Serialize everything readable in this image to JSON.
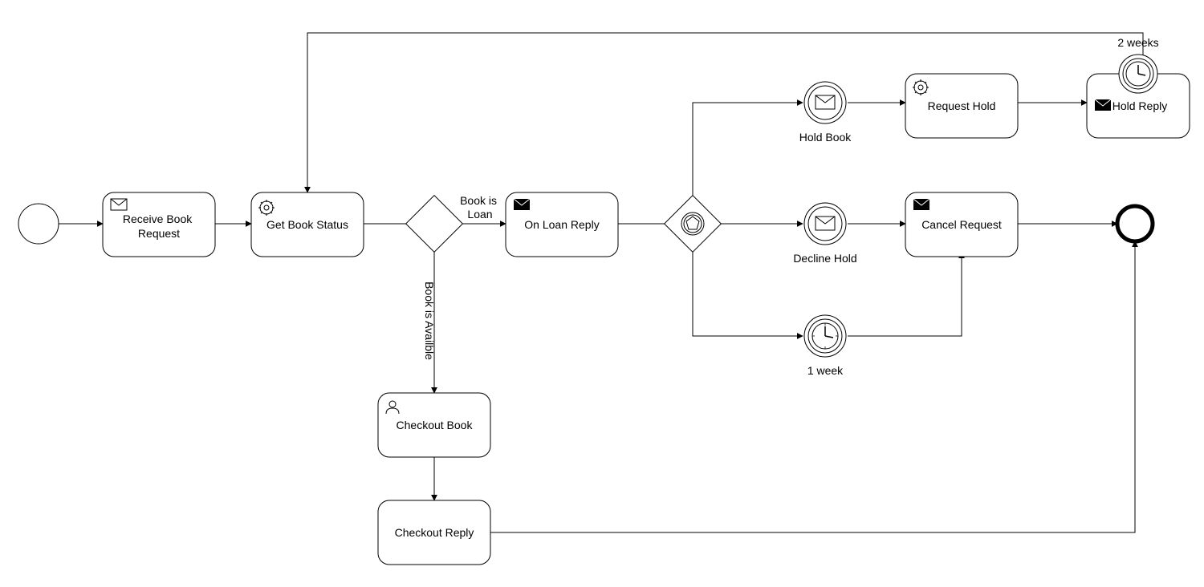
{
  "diagram": {
    "type": "BPMN",
    "events": {
      "start": {
        "label": ""
      },
      "end": {
        "label": ""
      },
      "hold_book": {
        "label": "Hold Book",
        "kind": "message-intermediate"
      },
      "decline_hold": {
        "label": "Decline Hold",
        "kind": "message-intermediate"
      },
      "one_week": {
        "label": "1 week",
        "kind": "timer-intermediate"
      },
      "two_weeks": {
        "label": "2 weeks",
        "kind": "timer-boundary"
      }
    },
    "tasks": {
      "receive_book_request": {
        "label": "Receive Book Request",
        "marker": "message"
      },
      "get_book_status": {
        "label": "Get Book Status",
        "marker": "service"
      },
      "on_loan_reply": {
        "label": "On Loan Reply",
        "marker": "message-filled"
      },
      "checkout_book": {
        "label": "Checkout Book",
        "marker": "user"
      },
      "checkout_reply": {
        "label": "Checkout Reply",
        "marker": ""
      },
      "request_hold": {
        "label": "Request Hold",
        "marker": "service"
      },
      "cancel_request": {
        "label": "Cancel Request",
        "marker": "message-filled"
      },
      "hold_reply": {
        "label": "Hold Reply",
        "marker": "message-filled"
      }
    },
    "gateways": {
      "g_status": {
        "type": "exclusive"
      },
      "g_event": {
        "type": "event-based"
      }
    },
    "flows": {
      "book_is_loan": "Book is Loan",
      "book_is_available": "Book is Availble"
    }
  }
}
